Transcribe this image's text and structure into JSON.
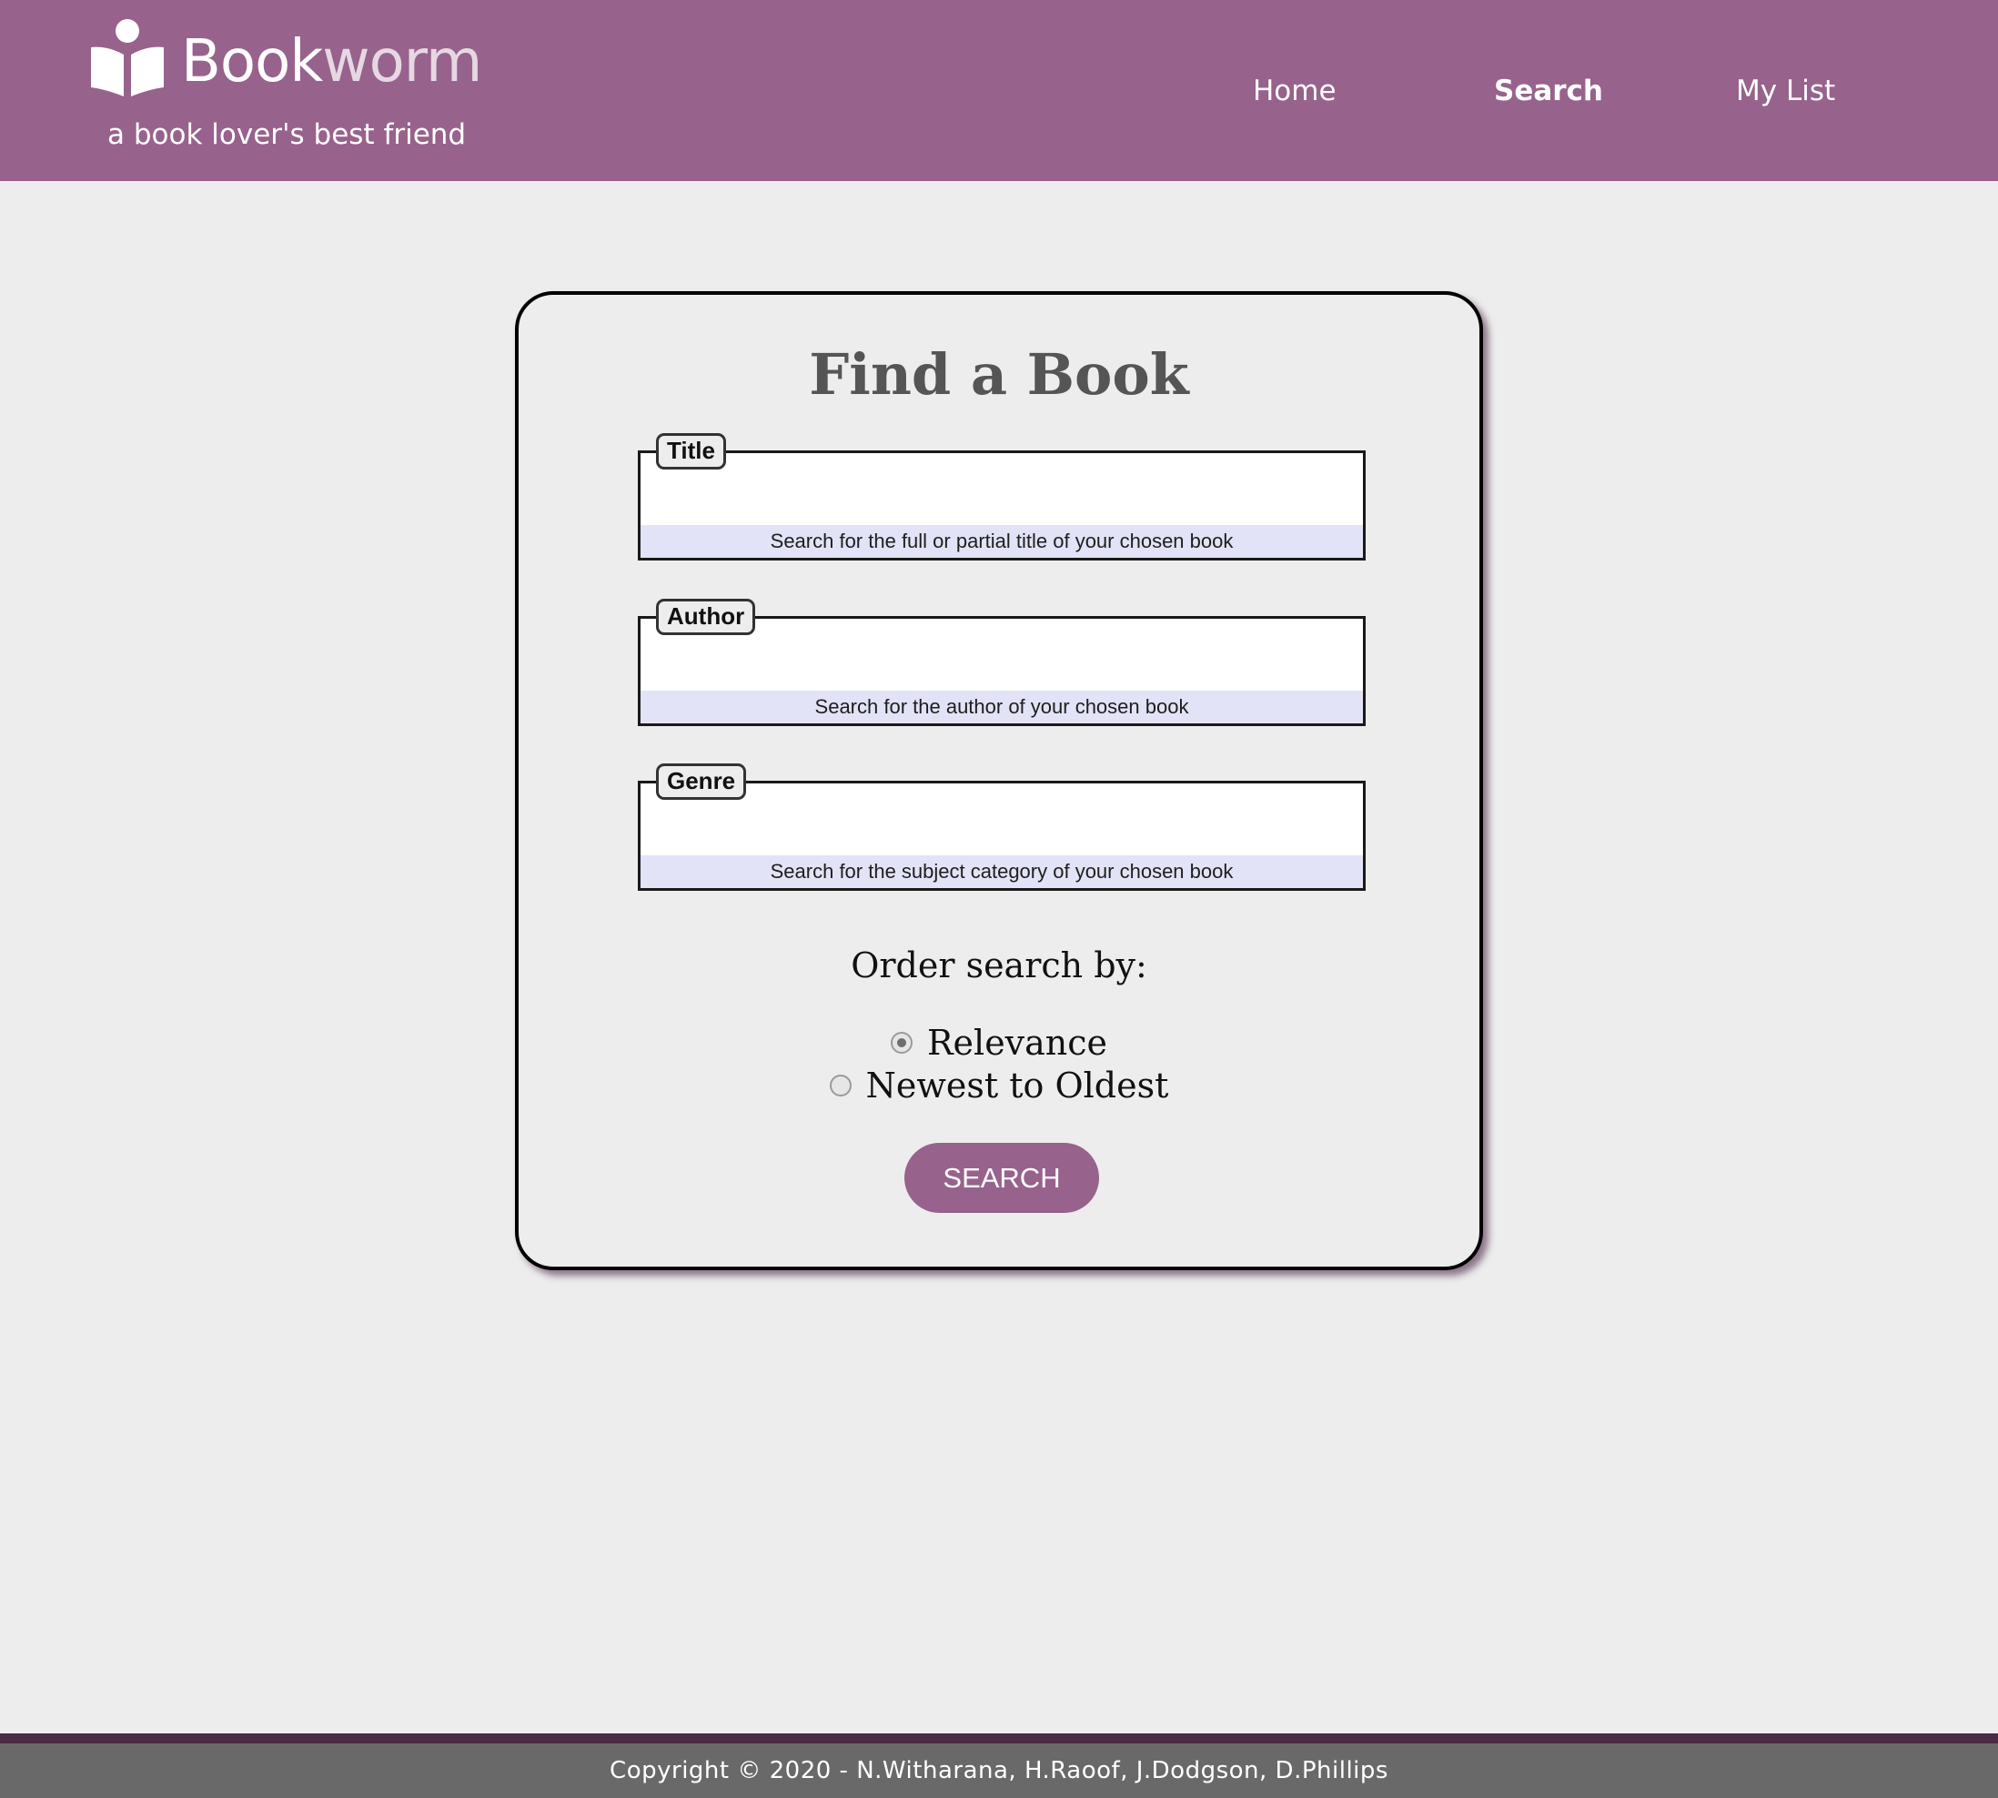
{
  "header": {
    "brand_part1": "Book",
    "brand_part2": "worm",
    "tagline": "a book lover's best friend",
    "logo_icon": "book-reader-icon",
    "nav": {
      "home": "Home",
      "search": "Search",
      "my_list": "My List"
    },
    "active_nav": "Search"
  },
  "main": {
    "title": "Find a Book",
    "fields": [
      {
        "legend": "Title",
        "value": "",
        "hint": "Search for the full or partial title of your chosen book"
      },
      {
        "legend": "Author",
        "value": "",
        "hint": "Search for the author of your chosen book"
      },
      {
        "legend": "Genre",
        "value": "",
        "hint": "Search for the subject category of your chosen book"
      }
    ],
    "order_label": "Order search by:",
    "order_options": [
      {
        "label": "Relevance",
        "selected": true
      },
      {
        "label": "Newest to Oldest",
        "selected": false
      }
    ],
    "search_button": "SEARCH"
  },
  "footer": {
    "copyright": "Copyright © 2020 - N.Witharana, H.Raoof, J.Dodgson, D.Phillips"
  },
  "colors": {
    "brand_purple": "#97628c",
    "page_background": "#ededed",
    "hint_background": "#e3e3f7",
    "footer_background": "#696969",
    "footer_accent": "#4a2a45"
  }
}
